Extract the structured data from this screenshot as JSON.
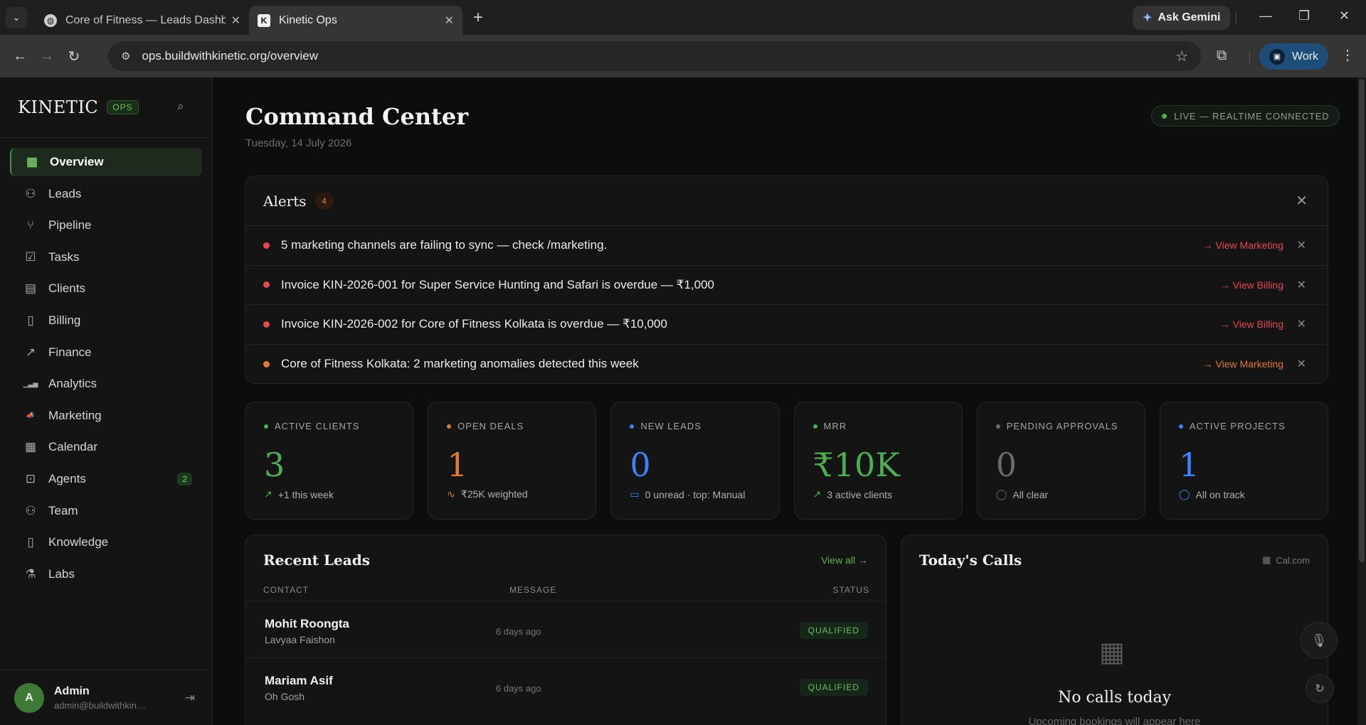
{
  "browser": {
    "tabs": [
      {
        "title": "Core of Fitness — Leads Dashboard",
        "active": false
      },
      {
        "title": "Kinetic Ops",
        "active": true
      }
    ],
    "ask_gemini": "Ask Gemini",
    "url": "ops.buildwithkinetic.org/overview",
    "profile": "Work"
  },
  "sidebar": {
    "logo": "KINETIC",
    "logo_tag": "OPS",
    "items": [
      {
        "label": "Overview",
        "icon": "grid-icon",
        "glyph": "▦"
      },
      {
        "label": "Leads",
        "icon": "users-icon",
        "glyph": "⚇"
      },
      {
        "label": "Pipeline",
        "icon": "branch-icon",
        "glyph": "⑂"
      },
      {
        "label": "Tasks",
        "icon": "checkbox-icon",
        "glyph": "☑"
      },
      {
        "label": "Clients",
        "icon": "briefcase-icon",
        "glyph": "▤"
      },
      {
        "label": "Billing",
        "icon": "document-icon",
        "glyph": "▯"
      },
      {
        "label": "Finance",
        "icon": "trend-icon",
        "glyph": "↗"
      },
      {
        "label": "Analytics",
        "icon": "bar-chart-icon",
        "glyph": "▁▃▅"
      },
      {
        "label": "Marketing",
        "icon": "megaphone-icon",
        "glyph": "📣"
      },
      {
        "label": "Calendar",
        "icon": "calendar-icon",
        "glyph": "▦"
      },
      {
        "label": "Agents",
        "icon": "robot-icon",
        "glyph": "⊡",
        "badge": "2"
      },
      {
        "label": "Team",
        "icon": "user-icon",
        "glyph": "⚇"
      },
      {
        "label": "Knowledge",
        "icon": "book-icon",
        "glyph": "▯"
      },
      {
        "label": "Labs",
        "icon": "flask-icon",
        "glyph": "⚗"
      }
    ],
    "user": {
      "initial": "A",
      "name": "Admin",
      "email": "admin@buildwithkinetic.org"
    }
  },
  "header": {
    "title": "Command Center",
    "date": "Tuesday, 14 July 2026",
    "live_status": "LIVE — REALTIME CONNECTED"
  },
  "alerts": {
    "title": "Alerts",
    "count": "4",
    "items": [
      {
        "text": "5 marketing channels are failing to sync — check /marketing.",
        "link": "→ View Marketing",
        "color": "#e5484d"
      },
      {
        "text": "Invoice KIN-2026-001 for Super Service Hunting and Safari is overdue — ₹1,000",
        "link": "→ View Billing",
        "color": "#e5484d"
      },
      {
        "text": "Invoice KIN-2026-002 for Core of Fitness Kolkata is overdue — ₹10,000",
        "link": "→ View Billing",
        "color": "#e5484d"
      },
      {
        "text": "Core of Fitness Kolkata: 2 marketing anomalies detected this week",
        "link": "→ View Marketing",
        "color": "#e07b2c"
      }
    ]
  },
  "kpis": [
    {
      "label": "ACTIVE CLIENTS",
      "value": "3",
      "sub": "+1 this week",
      "color": "#4caf50",
      "sub_glyph": "↗"
    },
    {
      "label": "OPEN DEALS",
      "value": "1",
      "sub": "₹25K weighted",
      "color": "#e07b2c",
      "sub_glyph": "∿"
    },
    {
      "label": "NEW LEADS",
      "value": "0",
      "sub": "0 unread · top: Manual",
      "color": "#3b82f6",
      "sub_glyph": "▭"
    },
    {
      "label": "MRR",
      "value": "₹10K",
      "sub": "3 active clients",
      "color": "#4caf50",
      "sub_glyph": "↗"
    },
    {
      "label": "PENDING APPROVALS",
      "value": "0",
      "sub": "All clear",
      "color": "#6b6b6b",
      "sub_glyph": "◯"
    },
    {
      "label": "ACTIVE PROJECTS",
      "value": "1",
      "sub": "All on track",
      "color": "#3b82f6",
      "sub_glyph": "◯"
    }
  ],
  "recent_leads": {
    "title": "Recent Leads",
    "view_all": "View all →",
    "columns": [
      "CONTACT",
      "MESSAGE",
      "STATUS"
    ],
    "rows": [
      {
        "name": "Mohit Roongta",
        "company": "Lavyaa Faishon",
        "message": "6 days ago",
        "status": "QUALIFIED"
      },
      {
        "name": "Mariam Asif",
        "company": "Oh Gosh",
        "message": "6 days ago",
        "status": "QUALIFIED"
      }
    ]
  },
  "todays_calls": {
    "title": "Today's Calls",
    "source": "Cal.com",
    "empty_title": "No calls today",
    "empty_sub": "Upcoming bookings will appear here"
  }
}
